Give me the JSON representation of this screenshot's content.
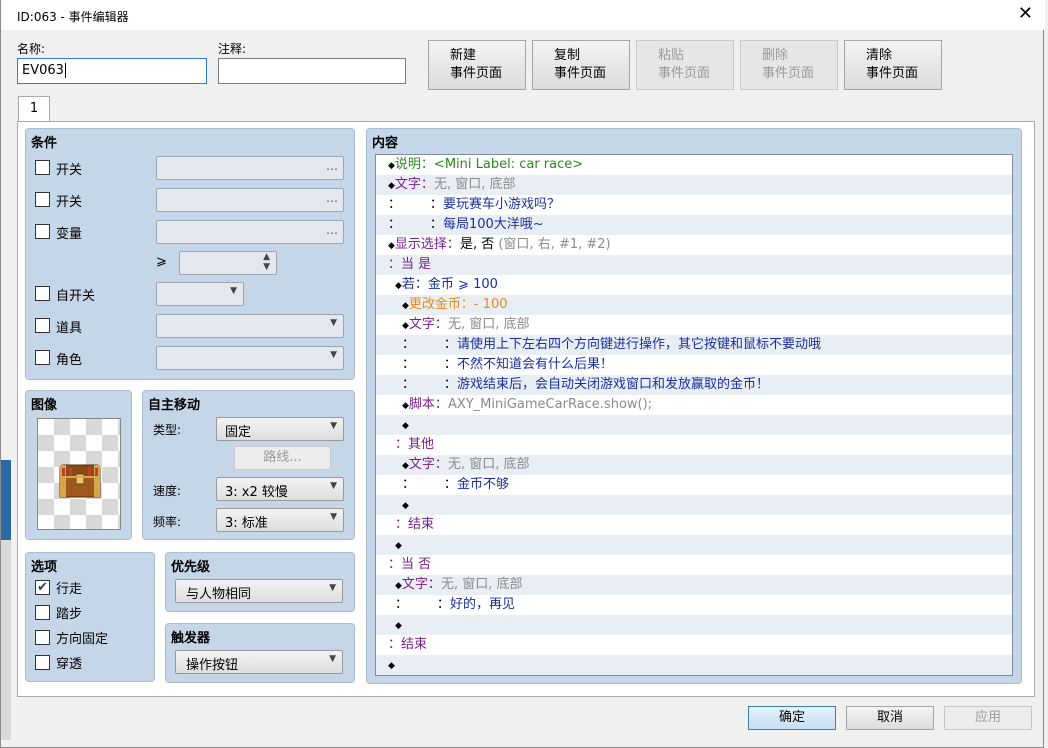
{
  "window": {
    "title": "ID:063 - 事件编辑器",
    "close_glyph": "✕"
  },
  "header": {
    "name_label": "名称:",
    "name_value": "EV063",
    "note_label": "注释:",
    "note_value": "",
    "buttons": [
      {
        "line1": "新建",
        "line2": "事件页面",
        "enabled": true
      },
      {
        "line1": "复制",
        "line2": "事件页面",
        "enabled": true
      },
      {
        "line1": "粘贴",
        "line2": "事件页面",
        "enabled": false
      },
      {
        "line1": "删除",
        "line2": "事件页面",
        "enabled": false
      },
      {
        "line1": "清除",
        "line2": "事件页面",
        "enabled": true
      }
    ]
  },
  "tabs": [
    {
      "label": "1"
    }
  ],
  "conditions": {
    "title": "条件",
    "items": [
      {
        "label": "开关",
        "checked": false,
        "value": "",
        "control": "ellipsis"
      },
      {
        "label": "开关",
        "checked": false,
        "value": "",
        "control": "ellipsis"
      },
      {
        "label": "变量",
        "checked": false,
        "value": "",
        "control": "ellipsis"
      },
      {
        "label": "自开关",
        "checked": false,
        "value": "",
        "control": "dropdown"
      },
      {
        "label": "道具",
        "checked": false,
        "value": "",
        "control": "dropdown"
      },
      {
        "label": "角色",
        "checked": false,
        "value": "",
        "control": "dropdown"
      }
    ],
    "ge_symbol": "⩾",
    "variable_value": ""
  },
  "image": {
    "title": "图像",
    "icon": "treasure-chest-icon"
  },
  "autonomous": {
    "title": "自主移动",
    "type_label": "类型:",
    "type_value": "固定",
    "route_button": "路线...",
    "speed_label": "速度:",
    "speed_value": "3: x2 较慢",
    "freq_label": "频率:",
    "freq_value": "3: 标准"
  },
  "options": {
    "title": "选项",
    "items": [
      {
        "label": "行走",
        "checked": true
      },
      {
        "label": "踏步",
        "checked": false
      },
      {
        "label": "方向固定",
        "checked": false
      },
      {
        "label": "穿透",
        "checked": false
      }
    ]
  },
  "priority": {
    "title": "优先级",
    "value": "与人物相同"
  },
  "trigger": {
    "title": "触发器",
    "value": "操作按钮"
  },
  "content": {
    "title": "内容",
    "lines": [
      {
        "indent": 0,
        "parts": [
          {
            "t": "◆",
            "c": "dia"
          },
          {
            "t": "说明：<Mini Label: car race>",
            "c": "green"
          }
        ]
      },
      {
        "indent": 0,
        "parts": [
          {
            "t": "◆",
            "c": "dia"
          },
          {
            "t": "文字：",
            "c": "purple"
          },
          {
            "t": "无, 窗口, 底部",
            "c": "gray"
          }
        ]
      },
      {
        "indent": 0,
        "parts": [
          {
            "t": "：       ：",
            "c": ""
          },
          {
            "t": "要玩赛车小游戏吗？",
            "c": "blue"
          }
        ]
      },
      {
        "indent": 0,
        "parts": [
          {
            "t": "：       ：",
            "c": ""
          },
          {
            "t": "每局100大洋哦~",
            "c": "blue"
          }
        ]
      },
      {
        "indent": 0,
        "parts": [
          {
            "t": "◆",
            "c": "dia"
          },
          {
            "t": "显示选择：",
            "c": "purple"
          },
          {
            "t": "是, 否 ",
            "c": ""
          },
          {
            "t": "(窗口, 右, #1, #2)",
            "c": "gray"
          }
        ]
      },
      {
        "indent": 0,
        "parts": [
          {
            "t": "：当 是",
            "c": "purple"
          }
        ]
      },
      {
        "indent": 1,
        "parts": [
          {
            "t": "◆",
            "c": "dia"
          },
          {
            "t": "若：金币 ⩾ 100",
            "c": "blue"
          }
        ]
      },
      {
        "indent": 2,
        "parts": [
          {
            "t": "◆",
            "c": "dia"
          },
          {
            "t": "更改金币：- 100",
            "c": "orange"
          }
        ]
      },
      {
        "indent": 2,
        "parts": [
          {
            "t": "◆",
            "c": "dia"
          },
          {
            "t": "文字：",
            "c": "purple"
          },
          {
            "t": "无, 窗口, 底部",
            "c": "gray"
          }
        ]
      },
      {
        "indent": 2,
        "parts": [
          {
            "t": "：       ：",
            "c": ""
          },
          {
            "t": "请使用上下左右四个方向键进行操作，其它按键和鼠标不要动哦",
            "c": "blue"
          }
        ]
      },
      {
        "indent": 2,
        "parts": [
          {
            "t": "：       ：",
            "c": ""
          },
          {
            "t": "不然不知道会有什么后果！",
            "c": "blue"
          }
        ]
      },
      {
        "indent": 2,
        "parts": [
          {
            "t": "：       ：",
            "c": ""
          },
          {
            "t": "游戏结束后，会自动关闭游戏窗口和发放赢取的金币！",
            "c": "blue"
          }
        ]
      },
      {
        "indent": 2,
        "parts": [
          {
            "t": "◆",
            "c": "dia"
          },
          {
            "t": "脚本：",
            "c": "purple"
          },
          {
            "t": "AXY_MiniGameCarRace.show();",
            "c": "gray"
          }
        ]
      },
      {
        "indent": 2,
        "parts": [
          {
            "t": "◆",
            "c": "dia"
          }
        ]
      },
      {
        "indent": 1,
        "parts": [
          {
            "t": "：其他",
            "c": "purple"
          }
        ]
      },
      {
        "indent": 2,
        "parts": [
          {
            "t": "◆",
            "c": "dia"
          },
          {
            "t": "文字：",
            "c": "purple"
          },
          {
            "t": "无, 窗口, 底部",
            "c": "gray"
          }
        ]
      },
      {
        "indent": 2,
        "parts": [
          {
            "t": "：       ：",
            "c": ""
          },
          {
            "t": "金币不够",
            "c": "blue"
          }
        ]
      },
      {
        "indent": 2,
        "parts": [
          {
            "t": "◆",
            "c": "dia"
          }
        ]
      },
      {
        "indent": 1,
        "parts": [
          {
            "t": "：结束",
            "c": "purple"
          }
        ]
      },
      {
        "indent": 1,
        "parts": [
          {
            "t": "◆",
            "c": "dia"
          }
        ]
      },
      {
        "indent": 0,
        "parts": [
          {
            "t": "：当 否",
            "c": "purple"
          }
        ]
      },
      {
        "indent": 1,
        "parts": [
          {
            "t": "◆",
            "c": "dia"
          },
          {
            "t": "文字：",
            "c": "purple"
          },
          {
            "t": "无, 窗口, 底部",
            "c": "gray"
          }
        ]
      },
      {
        "indent": 1,
        "parts": [
          {
            "t": "：       ：",
            "c": ""
          },
          {
            "t": "好的，再见",
            "c": "blue"
          }
        ]
      },
      {
        "indent": 1,
        "parts": [
          {
            "t": "◆",
            "c": "dia"
          }
        ]
      },
      {
        "indent": 0,
        "parts": [
          {
            "t": "：结束",
            "c": "purple"
          }
        ]
      },
      {
        "indent": 0,
        "parts": [
          {
            "t": "◆",
            "c": "dia"
          }
        ]
      }
    ]
  },
  "footer": {
    "ok": "确定",
    "cancel": "取消",
    "apply": "应用"
  },
  "colors": {
    "panel": "#c5d6e8",
    "accent": "#2f7ad9",
    "script_blue": "#1a2ea0",
    "command_purple": "#7a1f8c"
  }
}
